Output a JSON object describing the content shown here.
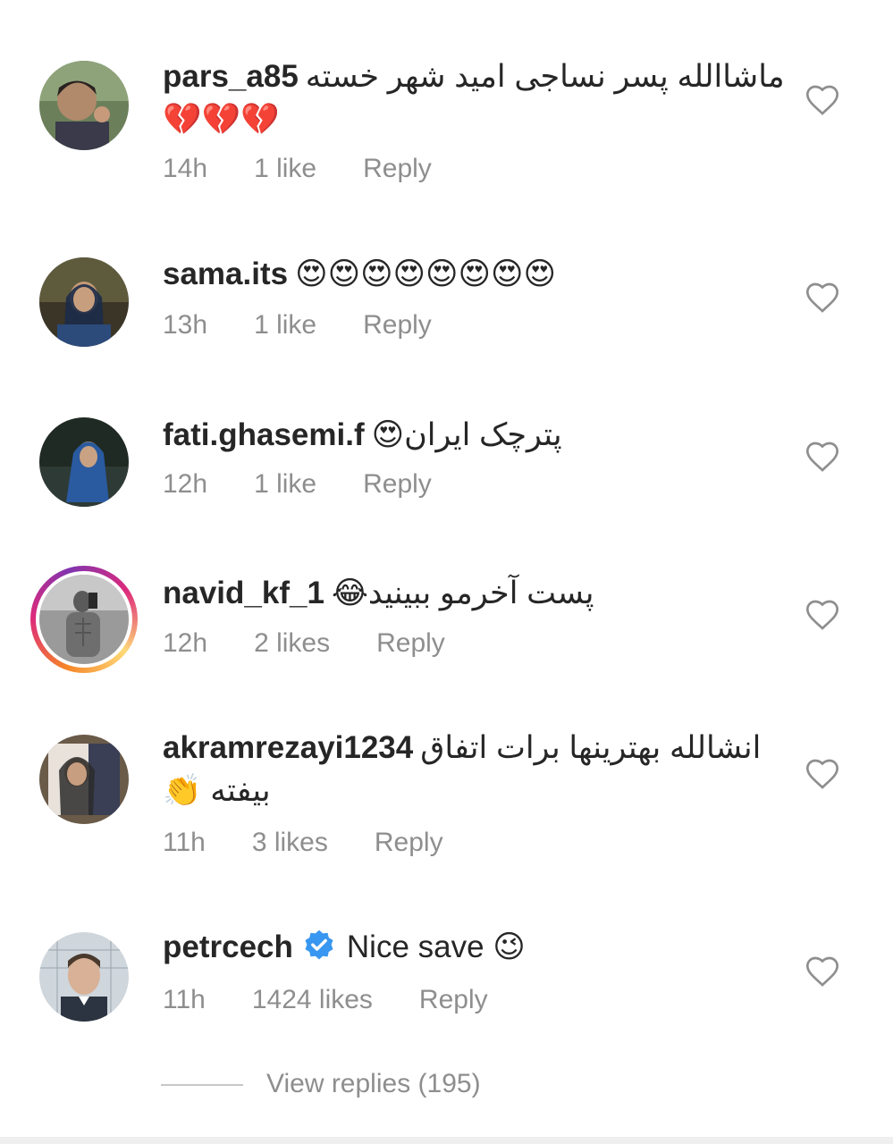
{
  "comments": [
    {
      "username": "pars_a85",
      "text": "ماشاالله پسر نساجی امید شهر خسته",
      "emoji_line2": "💔💔💔",
      "time": "14h",
      "likes": "1 like",
      "reply": "Reply",
      "avatar_icon": "user-photo-avatar"
    },
    {
      "username": "sama.its",
      "text": "😍😍😍😍😍😍😍😍",
      "time": "13h",
      "likes": "1 like",
      "reply": "Reply",
      "avatar_icon": "user-photo-avatar"
    },
    {
      "username": "fati.ghasemi.f",
      "text": "پترچک ایران😍",
      "time": "12h",
      "likes": "1 like",
      "reply": "Reply",
      "avatar_icon": "user-photo-avatar"
    },
    {
      "username": "navid_kf_1",
      "text": "پست آخرمو ببینید😂",
      "time": "12h",
      "likes": "2 likes",
      "reply": "Reply",
      "avatar_icon": "story-ring-avatar"
    },
    {
      "username": "akramrezayi1234",
      "text": "انشالله بهترینها برات اتفاق",
      "text_line2": "بیفته 👏",
      "time": "11h",
      "likes": "3 likes",
      "reply": "Reply",
      "avatar_icon": "user-photo-avatar"
    },
    {
      "username": "petrcech",
      "text": "Nice save 😉",
      "verified_icon": "verified-badge-icon",
      "time": "11h",
      "likes": "1424 likes",
      "reply": "Reply",
      "avatar_icon": "user-photo-avatar"
    }
  ],
  "view_replies": "View replies (195)",
  "colors": {
    "text": "#262626",
    "meta": "#8e8e8e",
    "verified": "#3897f0",
    "heart_outline": "#8e8e8e"
  }
}
